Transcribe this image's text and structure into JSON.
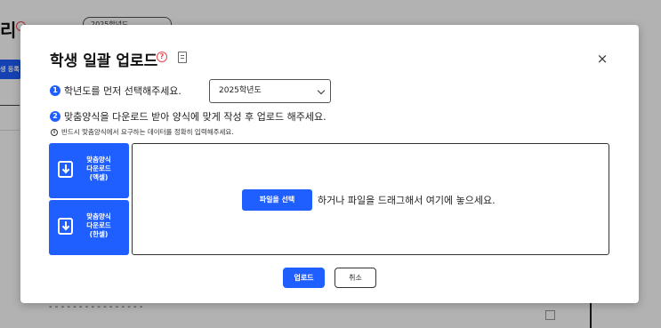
{
  "background": {
    "page_title_fragment": "리",
    "year_select_value": "2025학년도",
    "register_button_label": "생 등록",
    "bottom_text": "- - - - - - - - - - - - - - - -"
  },
  "modal": {
    "title": "학생 일괄 업로드",
    "close_symbol": "×",
    "step1": {
      "badge": "1",
      "text": "학년도를 먼저 선택해주세요.",
      "select_value": "2025학년도"
    },
    "step2": {
      "badge": "2",
      "text": "맞춤양식을 다운로드 받아 양식에 맞게 작성 후 업로드 해주세요."
    },
    "notice": {
      "icon": "i",
      "text": "반드시 맞춤양식에서 요구하는 데이터를 정확히 입력해주세요."
    },
    "download_buttons": [
      {
        "line1": "맞춤양식",
        "line2": "다운로드",
        "line3": "(엑셀)"
      },
      {
        "line1": "맞춤양식",
        "line2": "다운로드",
        "line3": "(한셀)"
      }
    ],
    "dropzone": {
      "file_button": "파일을 선택",
      "text": "하거나 파일을 드래그해서 여기에 놓으세요."
    },
    "upload_button": "업로드",
    "cancel_button": "취소"
  },
  "colors": {
    "accent": "#1f5eff",
    "help_icon": "#e5484d",
    "overlay": "rgba(0,0,0,0.30)"
  },
  "icons": [
    "help-circle-icon",
    "document-icon",
    "close-icon",
    "chevron-down-icon",
    "info-icon",
    "download-icon"
  ]
}
